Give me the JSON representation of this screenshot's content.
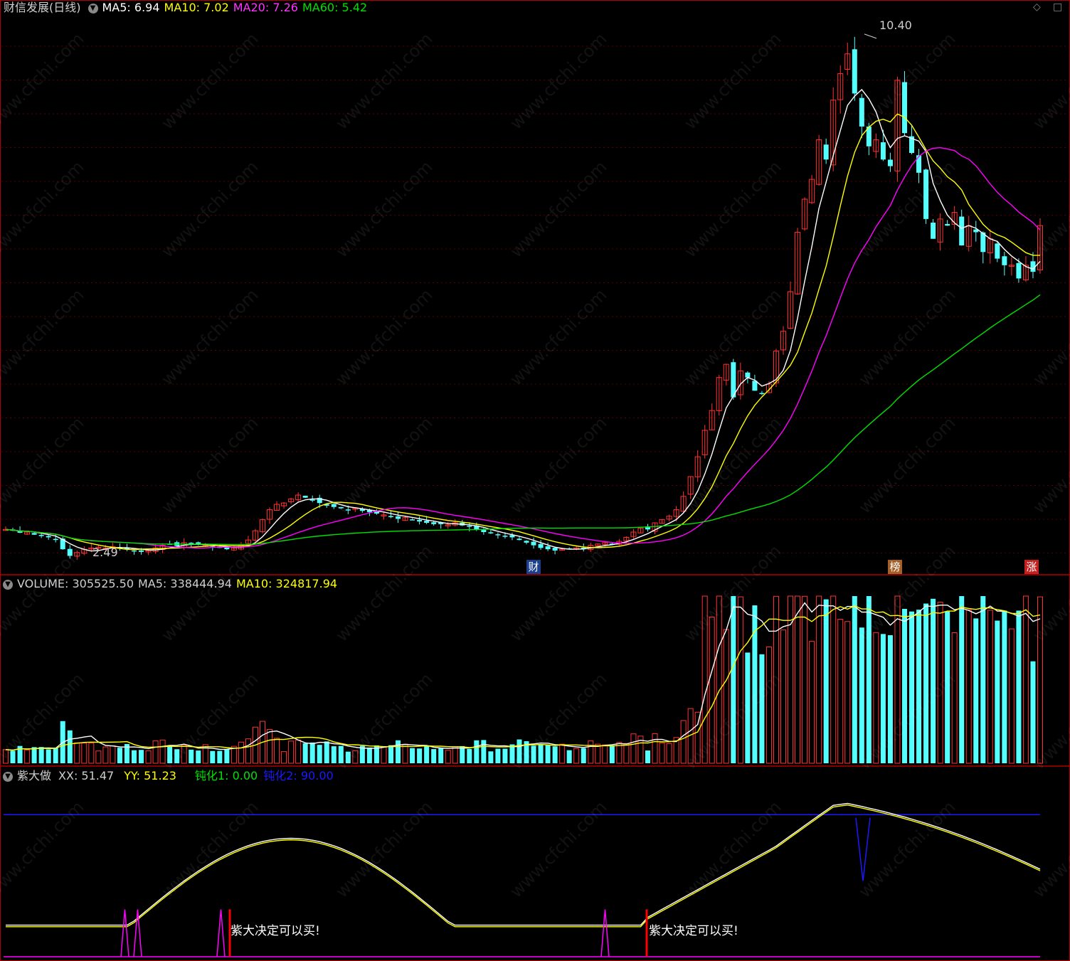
{
  "header": {
    "stock_name": "财信发展(日线)",
    "ma5": "MA5: 6.94",
    "ma10": "MA10: 7.02",
    "ma20": "MA20: 7.26",
    "ma60": "MA60: 5.42"
  },
  "price_panel": {
    "high_label": "10.40",
    "low_label": "2.49",
    "badges": [
      "财",
      "榜",
      "涨"
    ]
  },
  "volume_panel": {
    "volume": "VOLUME: 305525.50",
    "ma5": "MA5: 338444.94",
    "ma10": "MA10: 324817.94"
  },
  "indicator_panel": {
    "name": "紫大做",
    "xx": "XX: 51.47",
    "yy": "YY: 51.23",
    "dun1": "钝化1: 0.00",
    "dun2": "钝化2: 90.00",
    "signal_text": "紫大决定可以买!"
  },
  "watermark": "www.cfchi.com",
  "colors": {
    "up": "#ff3232",
    "down": "#54ffff",
    "ma5": "#ffffff",
    "ma10": "#ffff00",
    "ma20": "#ff00ff",
    "ma60": "#00e000",
    "border": "#b00000",
    "blue": "#1a1aff"
  },
  "chart_data": [
    {
      "type": "candlestick",
      "title": "财信发展(日线)",
      "series": [
        "MA5",
        "MA10",
        "MA20",
        "MA60"
      ],
      "ylim": [
        2.3,
        10.7
      ],
      "annotations": [
        "10.40",
        "2.49"
      ],
      "closes": [
        2.9,
        2.88,
        2.85,
        2.86,
        2.82,
        2.8,
        2.78,
        2.74,
        2.6,
        2.5,
        2.55,
        2.6,
        2.62,
        2.63,
        2.62,
        2.64,
        2.62,
        2.6,
        2.58,
        2.56,
        2.58,
        2.62,
        2.66,
        2.68,
        2.65,
        2.7,
        2.68,
        2.67,
        2.66,
        2.64,
        2.62,
        2.6,
        2.62,
        2.66,
        2.74,
        2.88,
        3.05,
        3.2,
        3.28,
        3.3,
        3.36,
        3.42,
        3.38,
        3.35,
        3.3,
        3.26,
        3.24,
        3.22,
        3.2,
        3.22,
        3.18,
        3.16,
        3.14,
        3.12,
        3.1,
        3.06,
        3.08,
        3.05,
        3.02,
        3.0,
        2.98,
        2.98,
        2.97,
        3.0,
        2.96,
        2.94,
        2.9,
        2.86,
        2.84,
        2.82,
        2.8,
        2.78,
        2.74,
        2.7,
        2.66,
        2.62,
        2.6,
        2.58,
        2.6,
        2.6,
        2.62,
        2.62,
        2.66,
        2.68,
        2.7,
        2.68,
        2.72,
        2.78,
        2.86,
        2.92,
        2.9,
        3.0,
        3.05,
        3.1,
        3.2,
        3.4,
        3.7,
        4.0,
        4.4,
        4.7,
        5.2,
        5.4,
        4.9,
        5.3,
        5.2,
        5.0,
        4.95,
        5.1,
        5.6,
        5.9,
        6.5,
        7.4,
        7.9,
        8.2,
        8.8,
        8.5,
        9.4,
        9.8,
        10.1,
        9.5,
        9.0,
        8.7,
        8.8,
        8.5,
        8.4,
        9.7,
        8.9,
        8.6,
        8.3,
        7.6,
        7.3,
        7.6,
        7.5,
        7.7,
        7.2,
        7.5,
        7.4,
        7.1,
        7.3,
        7.0,
        6.9,
        6.9,
        6.7,
        6.9,
        6.8,
        7.5
      ]
    },
    {
      "type": "bar",
      "title": "VOLUME",
      "series": [
        "VOLUME",
        "MA5",
        "MA10"
      ],
      "values": [
        305525.5,
        338444.94,
        324817.94
      ]
    },
    {
      "type": "line",
      "title": "紫大做",
      "series": [
        "XX",
        "YY",
        "钝化1",
        "钝化2"
      ],
      "values": [
        51.47,
        51.23,
        0.0,
        90.0
      ],
      "annotations": [
        "紫大决定可以买!",
        "紫大决定可以买!"
      ]
    }
  ]
}
